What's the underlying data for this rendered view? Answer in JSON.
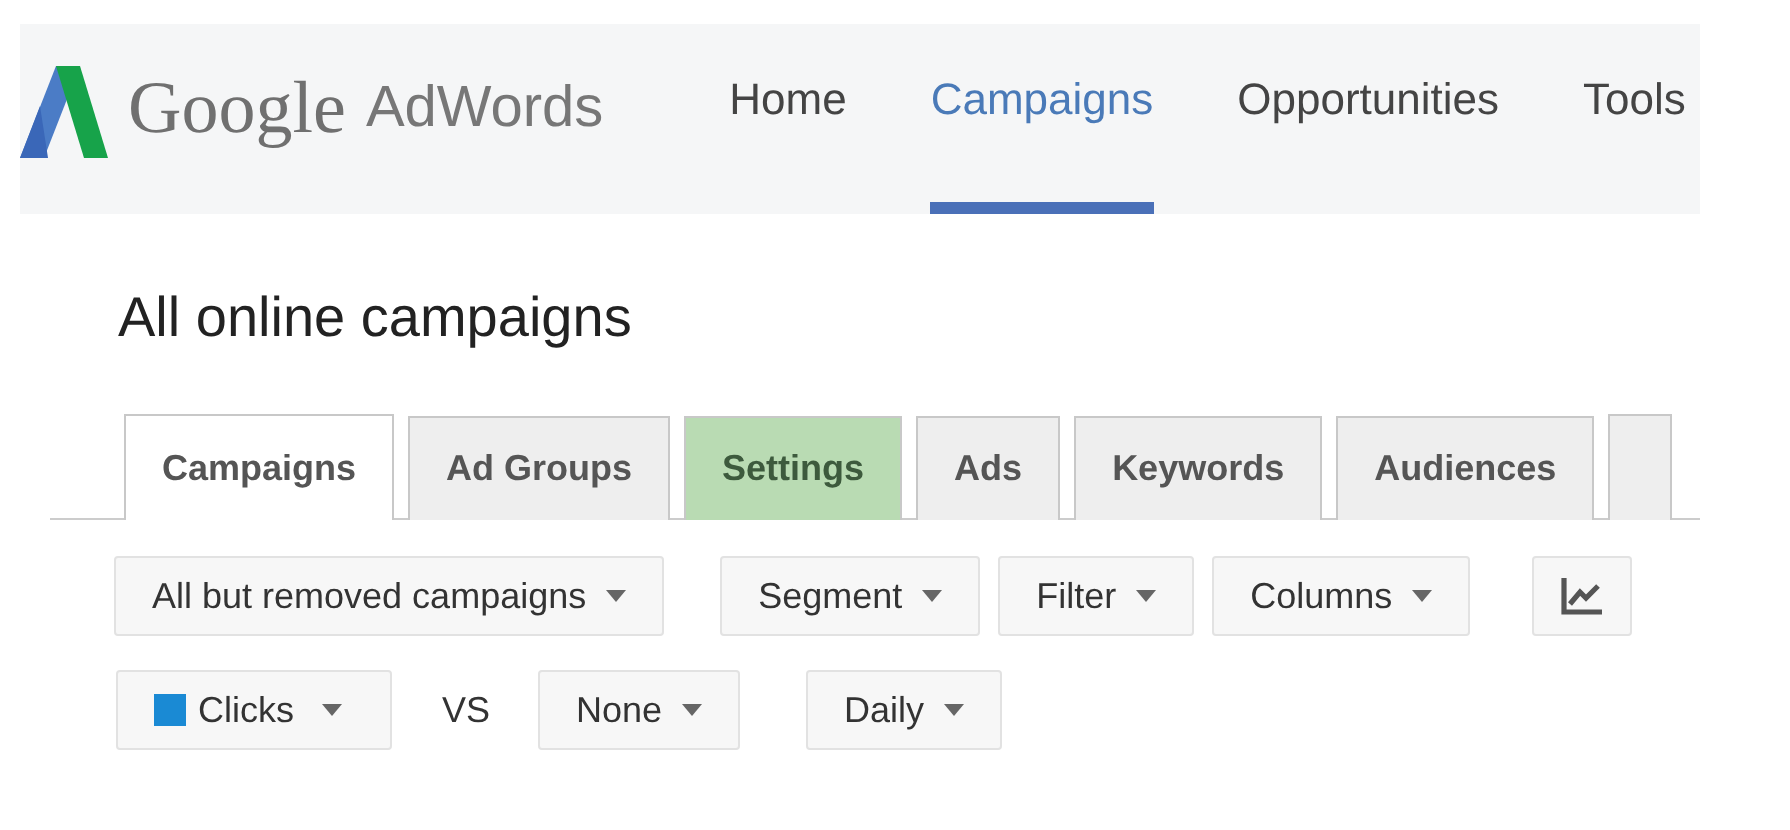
{
  "header": {
    "brand": "Google",
    "product": "AdWords",
    "nav": [
      {
        "label": "Home",
        "selected": false
      },
      {
        "label": "Campaigns",
        "selected": true
      },
      {
        "label": "Opportunities",
        "selected": false
      },
      {
        "label": "Tools",
        "selected": false
      }
    ]
  },
  "page_title": "All online campaigns",
  "tabs": [
    {
      "label": "Campaigns",
      "selected": true,
      "highlighted": false
    },
    {
      "label": "Ad Groups",
      "selected": false,
      "highlighted": false
    },
    {
      "label": "Settings",
      "selected": false,
      "highlighted": true
    },
    {
      "label": "Ads",
      "selected": false,
      "highlighted": false
    },
    {
      "label": "Keywords",
      "selected": false,
      "highlighted": false
    },
    {
      "label": "Audiences",
      "selected": false,
      "highlighted": false
    }
  ],
  "toolbar": [
    {
      "label": "All but removed campaigns",
      "gap": false
    },
    {
      "label": "Segment",
      "gap": true
    },
    {
      "label": "Filter",
      "gap": false
    },
    {
      "label": "Columns",
      "gap": false
    }
  ],
  "chart_options": {
    "metric": {
      "label": "Clicks",
      "color": "#1a8ad4"
    },
    "separator": "VS",
    "compare": "None",
    "period": "Daily"
  }
}
